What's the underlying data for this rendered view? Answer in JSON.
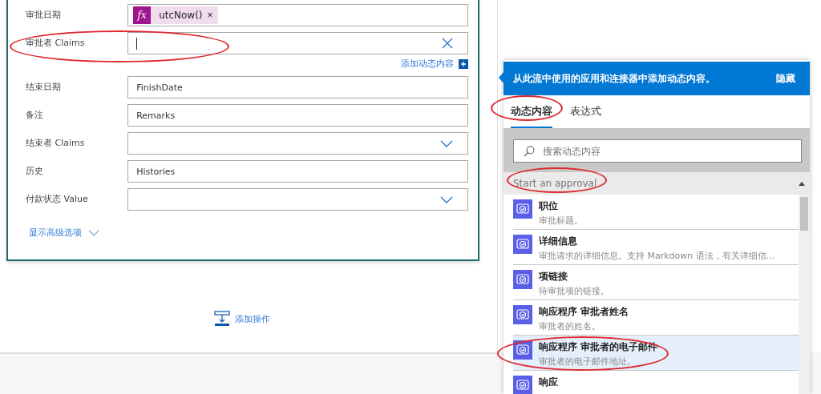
{
  "form": {
    "fields": [
      {
        "label": "审批日期",
        "kind": "token",
        "token": {
          "icon": "fx",
          "text": "utcNow()",
          "remove": "×"
        }
      },
      {
        "label": "审批者 Claims",
        "kind": "editing",
        "add_dynamic": "添加动态内容"
      },
      {
        "label": "结束日期",
        "kind": "text",
        "value": "FinishDate"
      },
      {
        "label": "备注",
        "kind": "text",
        "value": "Remarks"
      },
      {
        "label": "结束者 Claims",
        "kind": "dropdown"
      },
      {
        "label": "历史",
        "kind": "text",
        "value": "Histories"
      },
      {
        "label": "付款状态 Value",
        "kind": "dropdown"
      }
    ],
    "show_advanced": "显示高级选项"
  },
  "add_action": "添加操作",
  "dynamic_panel": {
    "header": "从此流中使用的应用和连接器中添加动态内容。",
    "hide": "隐藏",
    "tabs": [
      {
        "label": "动态内容",
        "selected": true
      },
      {
        "label": "表达式",
        "selected": false
      }
    ],
    "search": {
      "placeholder": "搜索动态内容"
    },
    "section": "Start an approval",
    "items": [
      {
        "title": "职位",
        "description": "审批标题。",
        "selected": false
      },
      {
        "title": "详细信息",
        "description": "审批请求的详细信息。支持 Markdown 语法，有关详细信...",
        "selected": false
      },
      {
        "title": "项链接",
        "description": "待审批项的链接。",
        "selected": false
      },
      {
        "title": "响应程序 审批者姓名",
        "description": "审批者的姓名。",
        "selected": false
      },
      {
        "title": "响应程序 审批者的电子邮件",
        "description": "审批者的电子邮件地址。",
        "selected": true
      },
      {
        "title": "响应",
        "selected": false
      }
    ]
  }
}
